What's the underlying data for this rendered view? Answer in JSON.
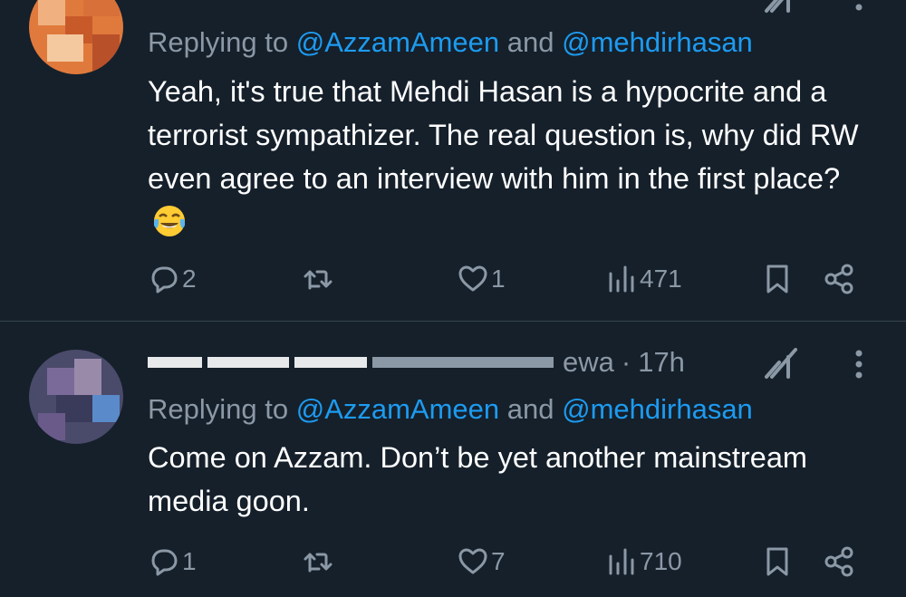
{
  "colors": {
    "background": "#15202b",
    "text": "#ffffff",
    "secondary": "#8b98a5",
    "link": "#1d9bf0",
    "divider": "#38444d"
  },
  "tweets": [
    {
      "replying_prefix": "Replying to ",
      "mention1": "@AzzamAmeen",
      "conjunction": " and ",
      "mention2": "@mehdirhasan",
      "body": "Yeah, it's true that Mehdi Hasan is a hypocrite and a terrorist sympathizer. The real question is, why did RW even agree to an interview with him in the first place?",
      "emoji": "face-with-tears-of-joy-icon",
      "replies": "2",
      "likes": "1",
      "views": "471"
    },
    {
      "handle_suffix": "ewa",
      "separator": "·",
      "time": "17h",
      "replying_prefix": "Replying to ",
      "mention1": "@AzzamAmeen",
      "conjunction": " and ",
      "mention2": "@mehdirhasan",
      "body": "Come on Azzam. Don’t be yet another mainstream media goon.",
      "replies": "1",
      "likes": "7",
      "views": "710"
    }
  ]
}
